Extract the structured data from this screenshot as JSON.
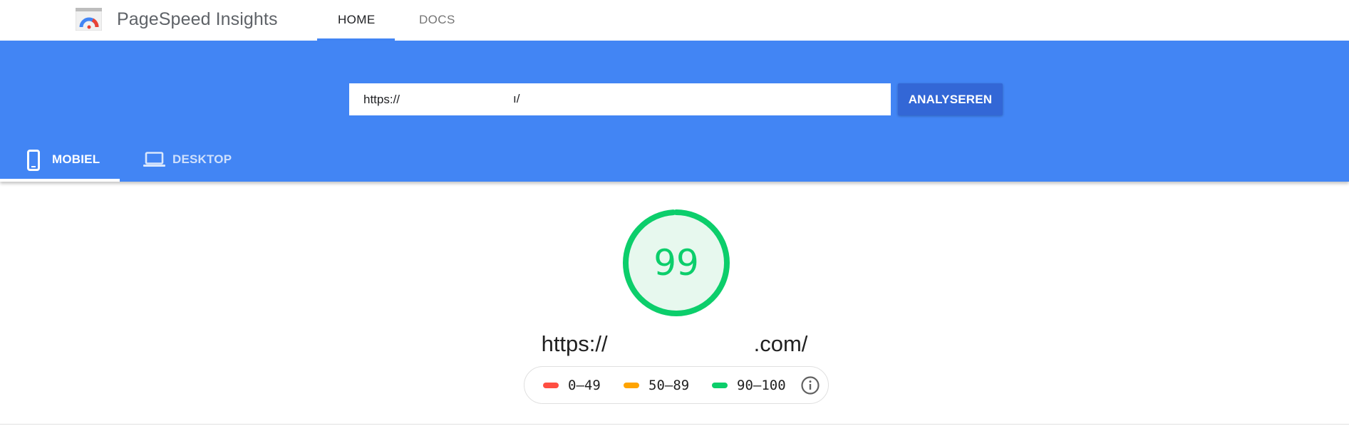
{
  "header": {
    "app_title": "PageSpeed Insights",
    "nav": [
      {
        "label": "HOME",
        "active": true
      },
      {
        "label": "DOCS",
        "active": false
      }
    ]
  },
  "search": {
    "url_prefix": "https://",
    "url_visible_tail": "ı/",
    "analyze_label": "ANALYSEREN"
  },
  "device_tabs": [
    {
      "label": "MOBIEL",
      "icon": "smartphone-icon",
      "active": true
    },
    {
      "label": "DESKTOP",
      "icon": "laptop-icon",
      "active": false
    }
  ],
  "result": {
    "score": "99",
    "score_fraction": 0.99,
    "url_prefix": "https://",
    "url_suffix": ".com/"
  },
  "legend": {
    "items": [
      {
        "label": "0–49",
        "color": "#ff4e42"
      },
      {
        "label": "50–89",
        "color": "#ffa400"
      },
      {
        "label": "90–100",
        "color": "#0cce6b"
      }
    ],
    "info_icon": "info-icon"
  },
  "colors": {
    "brand_blue": "#4285f4",
    "button_blue": "#3367d6",
    "score_green": "#0cce6b",
    "score_fill": "#e7f8ee"
  }
}
